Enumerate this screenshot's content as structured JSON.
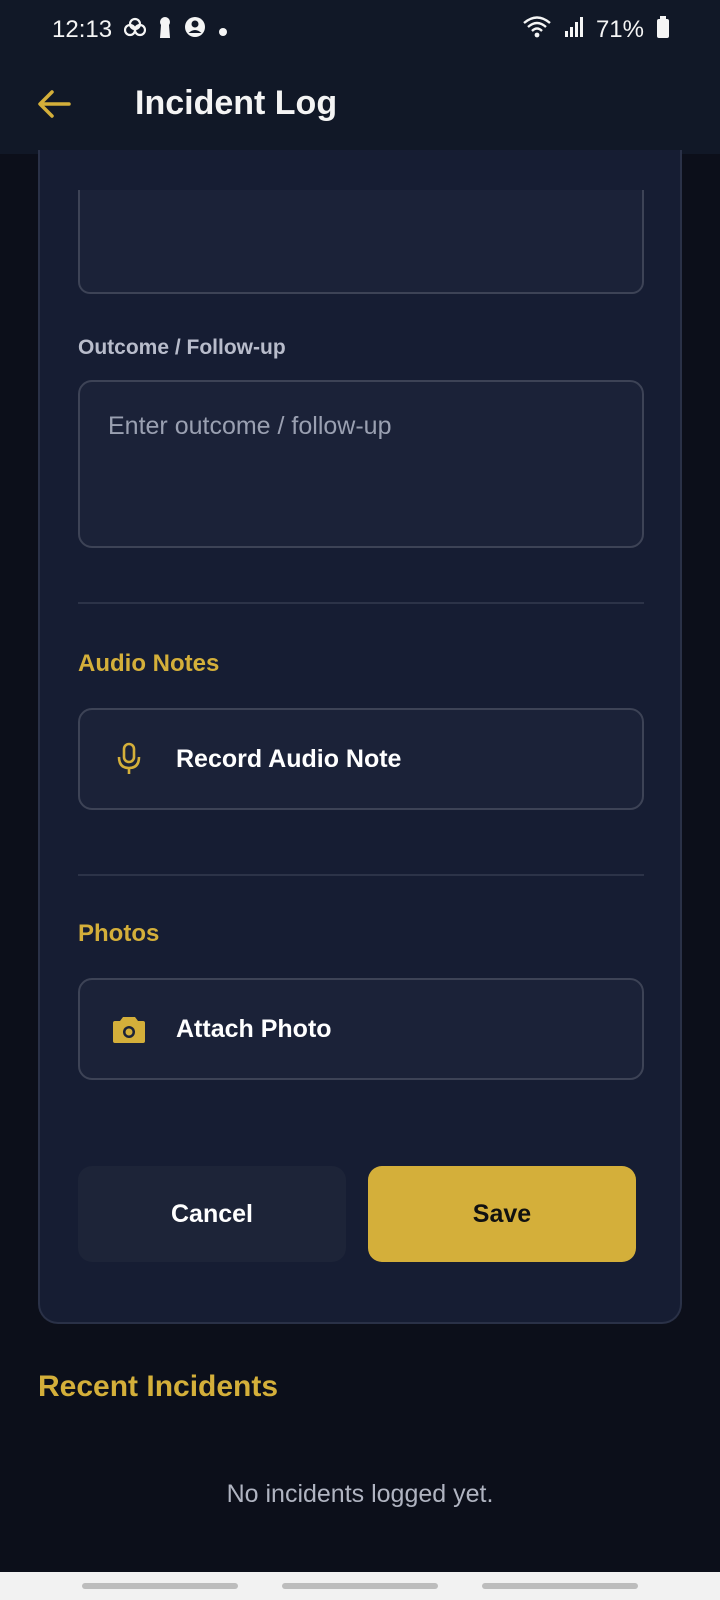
{
  "status_bar": {
    "time": "12:13",
    "battery": "71%",
    "icons_left": [
      "cloud-shapes-icon",
      "keyhole-icon",
      "account-circle-icon",
      "dot-icon"
    ],
    "icons_right": [
      "wifi-icon",
      "signal-icon",
      "battery-icon"
    ]
  },
  "app_bar": {
    "title": "Incident Log",
    "back_icon": "arrow-left-icon"
  },
  "form": {
    "outcome_label": "Outcome / Follow-up",
    "outcome_placeholder": "Enter outcome / follow-up",
    "outcome_value": "",
    "audio_section_title": "Audio Notes",
    "record_audio_label": "Record Audio Note",
    "photos_section_title": "Photos",
    "attach_photo_label": "Attach Photo",
    "cancel_label": "Cancel",
    "save_label": "Save"
  },
  "recent": {
    "title": "Recent Incidents",
    "empty_message": "No incidents logged yet."
  },
  "colors": {
    "accent": "#d4af3a",
    "background": "#0c0f1a",
    "card": "#161d33",
    "app_bar": "#111827"
  }
}
